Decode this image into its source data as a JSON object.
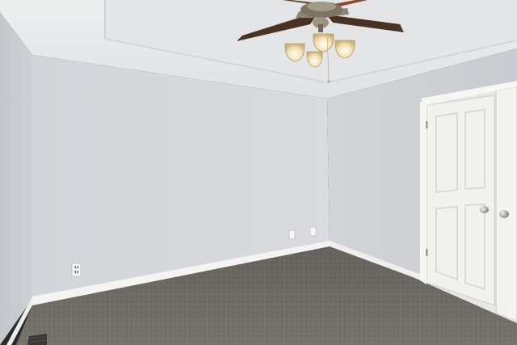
{
  "scene": {
    "description_tag": "empty-bedroom",
    "colors": {
      "wall_left": "#c9ccd1",
      "wall_back": "#d3d6da",
      "wall_right": "#cdd0d4",
      "ceiling": "#e6e8ea",
      "carpet": "#6e6b66",
      "trim": "#f4f4f2",
      "door": "#f1f1ee",
      "fan_blade": "#4a3222",
      "light_glass": "#f3dfb0"
    },
    "icons": [
      "ceiling-fan-icon",
      "outlet-icon",
      "door-knob-icon",
      "floor-vent-icon"
    ]
  }
}
